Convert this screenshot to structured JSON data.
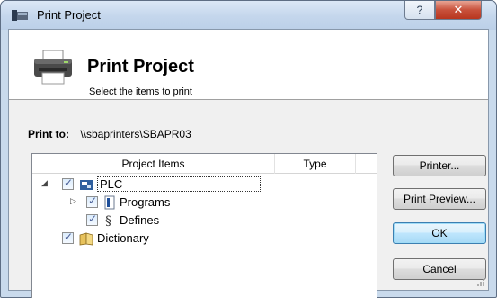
{
  "window": {
    "title": "Print Project",
    "help_label": "?",
    "close_label": "✕"
  },
  "header": {
    "title": "Print Project",
    "subtitle": "Select the items to print",
    "icon": "printer-icon"
  },
  "print_to": {
    "label": "Print to:",
    "value": "\\\\sbaprinters\\SBAPR03"
  },
  "tree": {
    "columns": [
      "Project Items",
      "Type"
    ],
    "items": [
      {
        "label": "PLC",
        "icon": "plc-icon",
        "checked": true,
        "expanded": true
      },
      {
        "label": "Programs",
        "icon": "programs-icon",
        "checked": true,
        "expanded": false
      },
      {
        "label": "Defines",
        "icon": "defines-icon",
        "checked": true
      },
      {
        "label": "Dictionary",
        "icon": "dictionary-icon",
        "checked": true
      }
    ]
  },
  "buttons": {
    "printer": "Printer...",
    "preview": "Print Preview...",
    "ok": "OK",
    "cancel": "Cancel"
  },
  "colors": {
    "frame": "#c9daec",
    "close": "#c8513b",
    "default_button": "#bee6fd"
  }
}
